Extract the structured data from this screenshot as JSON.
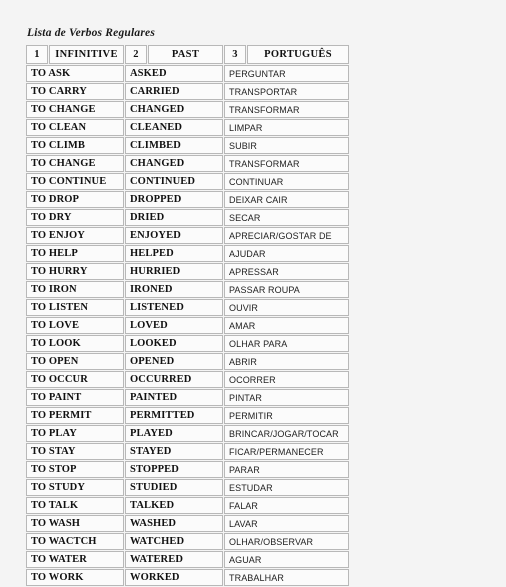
{
  "document": {
    "title": "Lista de Verbos Regulares"
  },
  "table": {
    "headers": [
      {
        "num": "1",
        "label": "INFINITIVE"
      },
      {
        "num": "2",
        "label": "PAST"
      },
      {
        "num": "3",
        "label": "PORTUGUÊS"
      }
    ],
    "rows": [
      {
        "infinitive": "TO ASK",
        "past": "ASKED",
        "portugues": "PERGUNTAR"
      },
      {
        "infinitive": "TO CARRY",
        "past": "CARRIED",
        "portugues": "TRANSPORTAR"
      },
      {
        "infinitive": "TO CHANGE",
        "past": "CHANGED",
        "portugues": "TRANSFORMAR"
      },
      {
        "infinitive": "TO CLEAN",
        "past": "CLEANED",
        "portugues": "LIMPAR"
      },
      {
        "infinitive": "TO CLIMB",
        "past": "CLIMBED",
        "portugues": "SUBIR"
      },
      {
        "infinitive": "TO CHANGE",
        "past": "CHANGED",
        "portugues": "TRANSFORMAR"
      },
      {
        "infinitive": "TO CONTINUE",
        "past": "CONTINUED",
        "portugues": "CONTINUAR"
      },
      {
        "infinitive": "TO DROP",
        "past": "DROPPED",
        "portugues": "DEIXAR CAIR"
      },
      {
        "infinitive": "TO DRY",
        "past": "DRIED",
        "portugues": "SECAR"
      },
      {
        "infinitive": "TO ENJOY",
        "past": "ENJOYED",
        "portugues": "APRECIAR/GOSTAR DE"
      },
      {
        "infinitive": "TO HELP",
        "past": "HELPED",
        "portugues": "AJUDAR"
      },
      {
        "infinitive": "TO HURRY",
        "past": "HURRIED",
        "portugues": "APRESSAR"
      },
      {
        "infinitive": "TO IRON",
        "past": "IRONED",
        "portugues": "PASSAR ROUPA"
      },
      {
        "infinitive": "TO LISTEN",
        "past": "LISTENED",
        "portugues": "OUVIR"
      },
      {
        "infinitive": "TO LOVE",
        "past": "LOVED",
        "portugues": "AMAR"
      },
      {
        "infinitive": "TO LOOK",
        "past": "LOOKED",
        "portugues": "OLHAR PARA"
      },
      {
        "infinitive": "TO OPEN",
        "past": "OPENED",
        "portugues": "ABRIR"
      },
      {
        "infinitive": "TO OCCUR",
        "past": "OCCURRED",
        "portugues": "OCORRER"
      },
      {
        "infinitive": "TO PAINT",
        "past": "PAINTED",
        "portugues": "PINTAR"
      },
      {
        "infinitive": "TO PERMIT",
        "past": "PERMITTED",
        "portugues": "PERMITIR"
      },
      {
        "infinitive": "TO PLAY",
        "past": "PLAYED",
        "portugues": "BRINCAR/JOGAR/TOCAR"
      },
      {
        "infinitive": "TO STAY",
        "past": "STAYED",
        "portugues": "FICAR/PERMANECER"
      },
      {
        "infinitive": "TO STOP",
        "past": "STOPPED",
        "portugues": "PARAR"
      },
      {
        "infinitive": "TO STUDY",
        "past": "STUDIED",
        "portugues": "ESTUDAR"
      },
      {
        "infinitive": "TO TALK",
        "past": "TALKED",
        "portugues": "FALAR"
      },
      {
        "infinitive": "TO WASH",
        "past": "WASHED",
        "portugues": "LAVAR"
      },
      {
        "infinitive": "TO WACTCH",
        "past": "WATCHED",
        "portugues": "OLHAR/OBSERVAR"
      },
      {
        "infinitive": "TO WATER",
        "past": "WATERED",
        "portugues": "AGUAR"
      },
      {
        "infinitive": "TO WORK",
        "past": "WORKED",
        "portugues": "TRABALHAR"
      }
    ]
  },
  "colors": {
    "page_background": "#f4f4f4",
    "cell_background": "#fbfbfb",
    "cell_border": "#b8b8b8",
    "text": "#111111"
  }
}
